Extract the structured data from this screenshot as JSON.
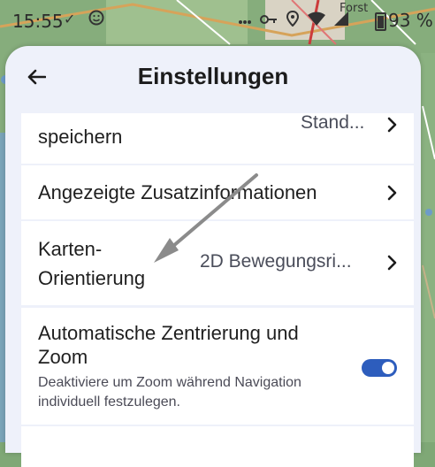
{
  "status_bar": {
    "time": "15:55",
    "check_glyph": "✓",
    "place": "Forst",
    "battery_percent": "93 %"
  },
  "header": {
    "title": "Einstellungen",
    "back_icon": "arrow-left-icon"
  },
  "settings": {
    "row_save": {
      "title": "speichern",
      "value": "Stand..."
    },
    "row_info": {
      "title": "Angezeigte Zusatzinformationen"
    },
    "row_orientation": {
      "title_line1": "Karten-",
      "title_line2": "Orientierung",
      "value": "2D Bewegungsri..."
    },
    "row_center": {
      "title_line1": "Automatische Zentrierung und",
      "title_line2": "Zoom",
      "desc_line1": "Deaktiviere um Zoom während Navigation",
      "desc_line2": "individuell festzulegen.",
      "toggle_on": true
    }
  },
  "colors": {
    "accent": "#2d5dbd",
    "sheet_bg": "#eef1fa",
    "card_bg": "#ffffff"
  }
}
